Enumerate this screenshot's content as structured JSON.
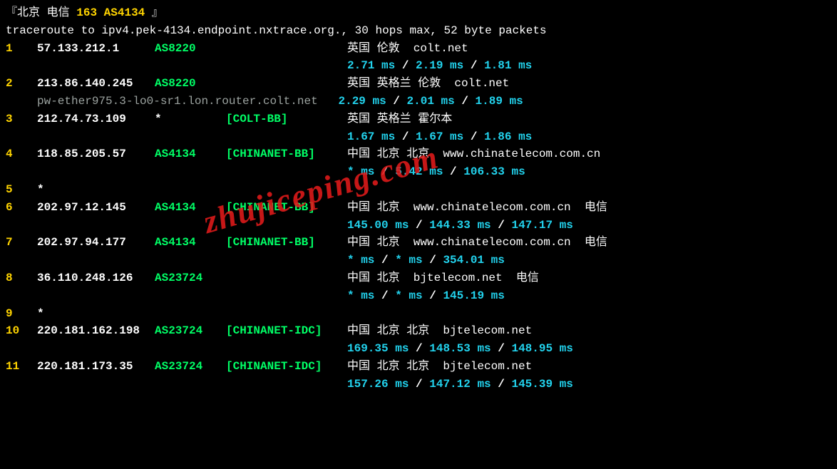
{
  "header": {
    "bracket_open": "『",
    "city": "北京",
    "isp": " 电信 ",
    "asn_label": "163 AS4134",
    "bracket_close": " 』"
  },
  "cmdline": "traceroute to ipv4.pek-4134.endpoint.nxtrace.org., 30 hops max, 52 byte packets",
  "watermark": "zhujiceping.com",
  "hops": [
    {
      "n": "1",
      "ip": "57.133.212.1",
      "asn": "AS8220",
      "tag": "",
      "loc": "英国 伦敦  colt.net",
      "times": [
        "2.71 ms",
        "2.19 ms",
        "1.81 ms"
      ]
    },
    {
      "n": "2",
      "ip": "213.86.140.245",
      "asn": "AS8220",
      "tag": "",
      "rdns": "pw-ether975.3-lo0-sr1.lon.router.colt.net",
      "loc": "英国 英格兰 伦敦  colt.net",
      "times": [
        "2.29 ms",
        "2.01 ms",
        "1.89 ms"
      ],
      "indent2": true
    },
    {
      "n": "3",
      "ip": "212.74.73.109",
      "asn": "*",
      "tag": "[COLT-BB]",
      "loc": "英国 英格兰 霍尔本",
      "times": [
        "1.67 ms",
        "1.67 ms",
        "1.86 ms"
      ]
    },
    {
      "n": "4",
      "ip": "118.85.205.57",
      "asn": "AS4134",
      "tag": "[CHINANET-BB]",
      "loc": "中国 北京 北京  www.chinatelecom.com.cn",
      "times": [
        "* ms",
        "5.42 ms",
        "106.33 ms"
      ]
    },
    {
      "n": "5",
      "ip": "*",
      "asn": "",
      "tag": "",
      "loc": ""
    },
    {
      "n": "6",
      "ip": "202.97.12.145",
      "asn": "AS4134",
      "tag": "[CHINANET-BB]",
      "loc": "中国 北京  www.chinatelecom.com.cn  电信",
      "times": [
        "145.00 ms",
        "144.33 ms",
        "147.17 ms"
      ]
    },
    {
      "n": "7",
      "ip": "202.97.94.177",
      "asn": "AS4134",
      "tag": "[CHINANET-BB]",
      "loc": "中国 北京  www.chinatelecom.com.cn  电信",
      "times": [
        "* ms",
        "* ms",
        "354.01 ms"
      ]
    },
    {
      "n": "8",
      "ip": "36.110.248.126",
      "asn": "AS23724",
      "tag": "",
      "loc": "中国 北京  bjtelecom.net  电信",
      "times": [
        "* ms",
        "* ms",
        "145.19 ms"
      ]
    },
    {
      "n": "9",
      "ip": "*",
      "asn": "",
      "tag": "",
      "loc": ""
    },
    {
      "n": "10",
      "ip": "220.181.162.198",
      "asn": "AS23724",
      "tag": "[CHINANET-IDC]",
      "loc": "中国 北京 北京  bjtelecom.net",
      "times": [
        "169.35 ms",
        "148.53 ms",
        "148.95 ms"
      ]
    },
    {
      "n": "11",
      "ip": "220.181.173.35",
      "asn": "AS23724",
      "tag": "[CHINANET-IDC]",
      "loc": "中国 北京 北京  bjtelecom.net",
      "times": [
        "157.26 ms",
        "147.12 ms",
        "145.39 ms"
      ]
    }
  ]
}
